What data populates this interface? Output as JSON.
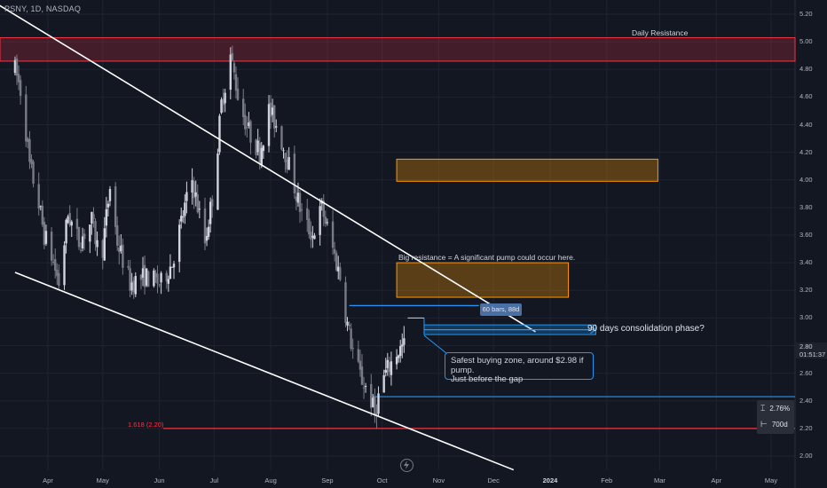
{
  "header": {
    "ticker_text": "PSNY, 1D, NASDAQ"
  },
  "price_axis": {
    "labels": [
      "5.20",
      "5.00",
      "4.80",
      "4.60",
      "4.40",
      "4.20",
      "4.00",
      "3.80",
      "3.60",
      "3.40",
      "3.20",
      "3.00",
      "2.80",
      "2.60",
      "2.40",
      "2.20",
      "2.00"
    ],
    "current_price": "2.80",
    "countdown": "01:51:37"
  },
  "time_axis": {
    "labels": [
      "Apr",
      "May",
      "Jun",
      "Jul",
      "Aug",
      "Sep",
      "Oct",
      "Nov",
      "Dec",
      "2024",
      "Feb",
      "Mar",
      "Apr",
      "May"
    ]
  },
  "annotations": {
    "daily_resistance": "Daily Resistance",
    "big_resistance": "Big resistance = A significant pump could occur here.",
    "consolidation": "90 days consolidation phase?",
    "measure_label": "60 bars, 88d",
    "buying_zone_line1": "Safest buying zone, around $2.98 if pump.",
    "buying_zone_line2": "Just before the gap",
    "fib_label": "1.618 (2.20)"
  },
  "stats": {
    "percent": "2.76%",
    "days": "700d"
  },
  "colors": {
    "background": "#131722",
    "up_candle": "#d1d4dc",
    "down_candle": "#787b86",
    "resistance_zone": "#f23645",
    "orange_zone": "#ff9800",
    "cyan_line": "#2196f3",
    "trend_line": "#ffffff"
  },
  "chart_data": {
    "type": "candlestick",
    "ylim": [
      1.95,
      5.25
    ],
    "y_ticks": [
      2.0,
      2.2,
      2.4,
      2.6,
      2.8,
      3.0,
      3.2,
      3.4,
      3.6,
      3.8,
      4.0,
      4.2,
      4.4,
      4.6,
      4.8,
      5.0,
      5.2
    ],
    "x_range": [
      "2023-03-14",
      "2024-05-20"
    ],
    "price_path": [
      [
        "2023-03-14",
        4.8
      ],
      [
        "2023-03-18",
        4.6
      ],
      [
        "2023-03-22",
        4.1
      ],
      [
        "2023-03-26",
        3.9
      ],
      [
        "2023-03-30",
        3.6
      ],
      [
        "2023-04-03",
        3.45
      ],
      [
        "2023-04-07",
        3.25
      ],
      [
        "2023-04-12",
        3.75
      ],
      [
        "2023-04-18",
        3.55
      ],
      [
        "2023-04-25",
        3.7
      ],
      [
        "2023-04-30",
        3.4
      ],
      [
        "2023-05-05",
        3.95
      ],
      [
        "2023-05-09",
        3.55
      ],
      [
        "2023-05-16",
        3.25
      ],
      [
        "2023-05-24",
        3.3
      ],
      [
        "2023-06-02",
        3.25
      ],
      [
        "2023-06-08",
        3.4
      ],
      [
        "2023-06-14",
        3.75
      ],
      [
        "2023-06-19",
        4.0
      ],
      [
        "2023-06-26",
        3.55
      ],
      [
        "2023-07-01",
        3.95
      ],
      [
        "2023-07-05",
        4.55
      ],
      [
        "2023-07-10",
        4.9
      ],
      [
        "2023-07-15",
        4.55
      ],
      [
        "2023-07-20",
        4.35
      ],
      [
        "2023-07-26",
        4.2
      ],
      [
        "2023-07-31",
        4.5
      ],
      [
        "2023-08-04",
        4.4
      ],
      [
        "2023-08-09",
        4.2
      ],
      [
        "2023-08-14",
        3.95
      ],
      [
        "2023-08-19",
        3.7
      ],
      [
        "2023-08-24",
        3.6
      ],
      [
        "2023-08-29",
        3.8
      ],
      [
        "2023-09-04",
        3.5
      ],
      [
        "2023-09-08",
        3.3
      ],
      [
        "2023-09-12",
        2.95
      ],
      [
        "2023-09-16",
        2.7
      ],
      [
        "2023-09-20",
        2.55
      ],
      [
        "2023-09-24",
        2.45
      ],
      [
        "2023-09-27",
        2.3
      ],
      [
        "2023-10-01",
        2.55
      ],
      [
        "2023-10-05",
        2.65
      ],
      [
        "2023-10-09",
        2.75
      ],
      [
        "2023-10-13",
        2.8
      ]
    ],
    "resistance_zone": {
      "label": "Daily Resistance",
      "low": 4.86,
      "high": 5.03
    },
    "orange_zones": [
      {
        "low": 3.99,
        "high": 4.15,
        "from": "2023-10-09",
        "to": "2024-02-29"
      },
      {
        "low": 3.15,
        "high": 3.4,
        "from": "2023-10-09",
        "to": "2024-01-11"
      }
    ],
    "trend_lines": [
      {
        "points": [
          [
            "2023-03-01",
            5.3
          ],
          [
            "2023-12-24",
            2.9
          ]
        ],
        "color": "#ffffff"
      },
      {
        "points": [
          [
            "2023-03-14",
            3.33
          ],
          [
            "2023-12-12",
            1.9
          ]
        ],
        "color": "#ffffff"
      }
    ],
    "horizontal_lines": [
      {
        "value": 2.2,
        "label": "1.618 (2.20)",
        "color": "#f23645"
      },
      {
        "value": 3.09,
        "color": "#2196f3",
        "from": "2023-09-13",
        "to": "2023-11-23"
      },
      {
        "value": 2.43,
        "color": "#2196f3",
        "from": "2023-09-26",
        "to": "2024-05-30"
      }
    ],
    "consolidation_range": {
      "from": "2023-10-24",
      "to": "2024-01-26",
      "low": 2.88,
      "high": 2.95
    }
  }
}
